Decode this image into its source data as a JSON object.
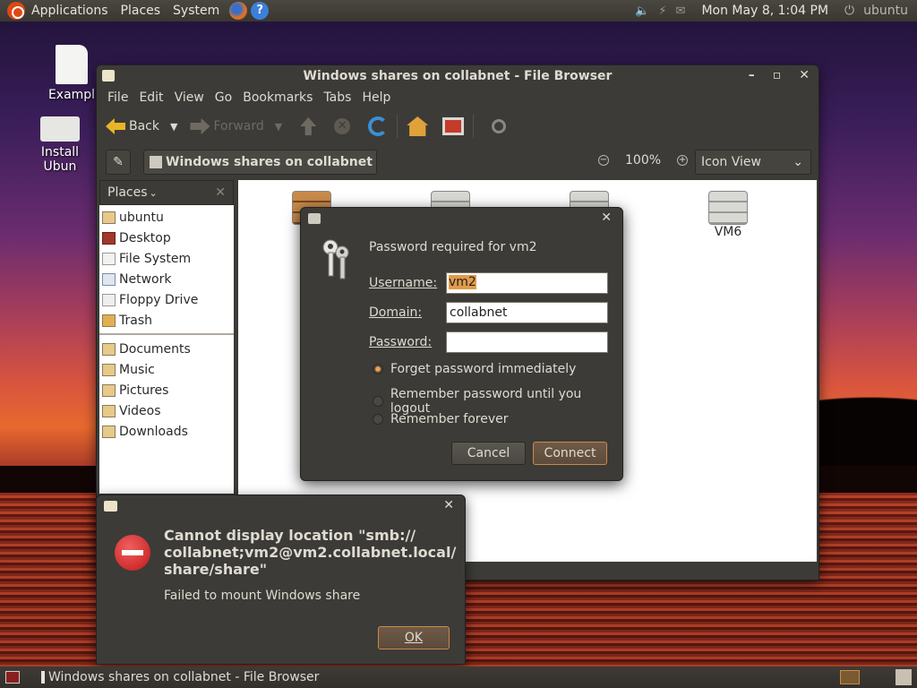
{
  "top_panel": {
    "menus": [
      "Applications",
      "Places",
      "System"
    ],
    "clock": "Mon May  8,  1:04 PM",
    "user": "ubuntu"
  },
  "desktop_icons": [
    {
      "label": "Exampl"
    },
    {
      "label": "Install Ubun"
    }
  ],
  "file_browser": {
    "title": "Windows shares on collabnet - File Browser",
    "menu": [
      "File",
      "Edit",
      "View",
      "Go",
      "Bookmarks",
      "Tabs",
      "Help"
    ],
    "toolbar": {
      "back": "Back",
      "forward": "Forward"
    },
    "location": "Windows shares on collabnet",
    "zoom": "100%",
    "view_mode": "Icon View",
    "sidebar": {
      "header": "Places",
      "items": [
        "ubuntu",
        "Desktop",
        "File System",
        "Network",
        "Floppy Drive",
        "Trash"
      ],
      "bookmarks": [
        "Documents",
        "Music",
        "Pictures",
        "Videos",
        "Downloads"
      ]
    },
    "servers": [
      {
        "label": ""
      },
      {
        "label": ""
      },
      {
        "label": ""
      },
      {
        "label": "VM6"
      }
    ]
  },
  "password_dialog": {
    "message": "Password required for vm2",
    "username_label": "Username:",
    "username_value": "vm2",
    "domain_label": "Domain:",
    "domain_value": "collabnet",
    "password_label": "Password:",
    "password_value": "",
    "options": [
      "Forget password immediately",
      "Remember password until you logout",
      "Remember forever"
    ],
    "selected_option": 0,
    "cancel": "Cancel",
    "connect": "Connect"
  },
  "error_dialog": {
    "title_line1": "Cannot display location \"smb://",
    "title_line2": "collabnet;vm2@vm2.collabnet.local/",
    "title_line3": "share/share\"",
    "message": "Failed to mount Windows share",
    "ok": "OK"
  },
  "taskbar": {
    "task_label": "Windows shares on collabnet - File Browser"
  }
}
